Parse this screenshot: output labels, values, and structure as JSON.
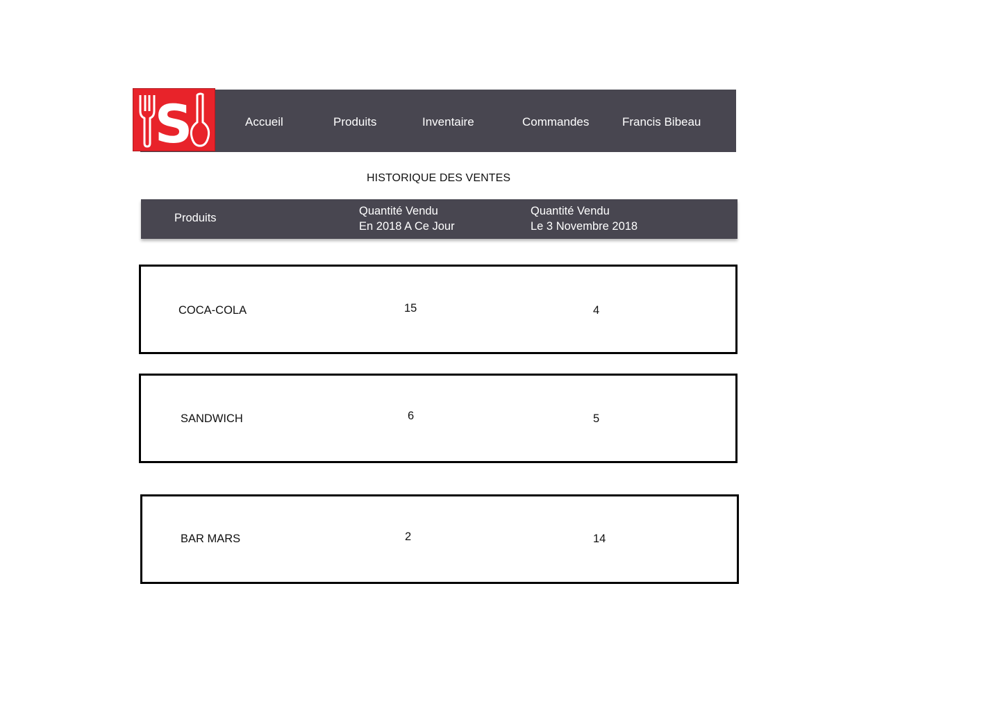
{
  "nav": {
    "logo_letter": "S",
    "items": [
      "Accueil",
      "Produits",
      "Inventaire",
      "Commandes",
      "Francis Bibeau"
    ]
  },
  "page": {
    "title": "HISTORIQUE DES VENTES"
  },
  "table": {
    "headers": {
      "product": "Produits",
      "qty_year_line1": "Quantité Vendu",
      "qty_year_line2": "En 2018 A Ce Jour",
      "qty_day_line1": "Quantité Vendu",
      "qty_day_line2": "Le 3 Novembre 2018"
    },
    "rows": [
      {
        "product": "COCA-COLA",
        "qty_year": "15",
        "qty_day": "4"
      },
      {
        "product": "SANDWICH",
        "qty_year": "6",
        "qty_day": "5"
      },
      {
        "product": "BAR MARS",
        "qty_year": "2",
        "qty_day": "14"
      }
    ]
  },
  "colors": {
    "nav_bg": "#484650",
    "logo_bg": "#e8232a",
    "row_border": "#000000"
  }
}
